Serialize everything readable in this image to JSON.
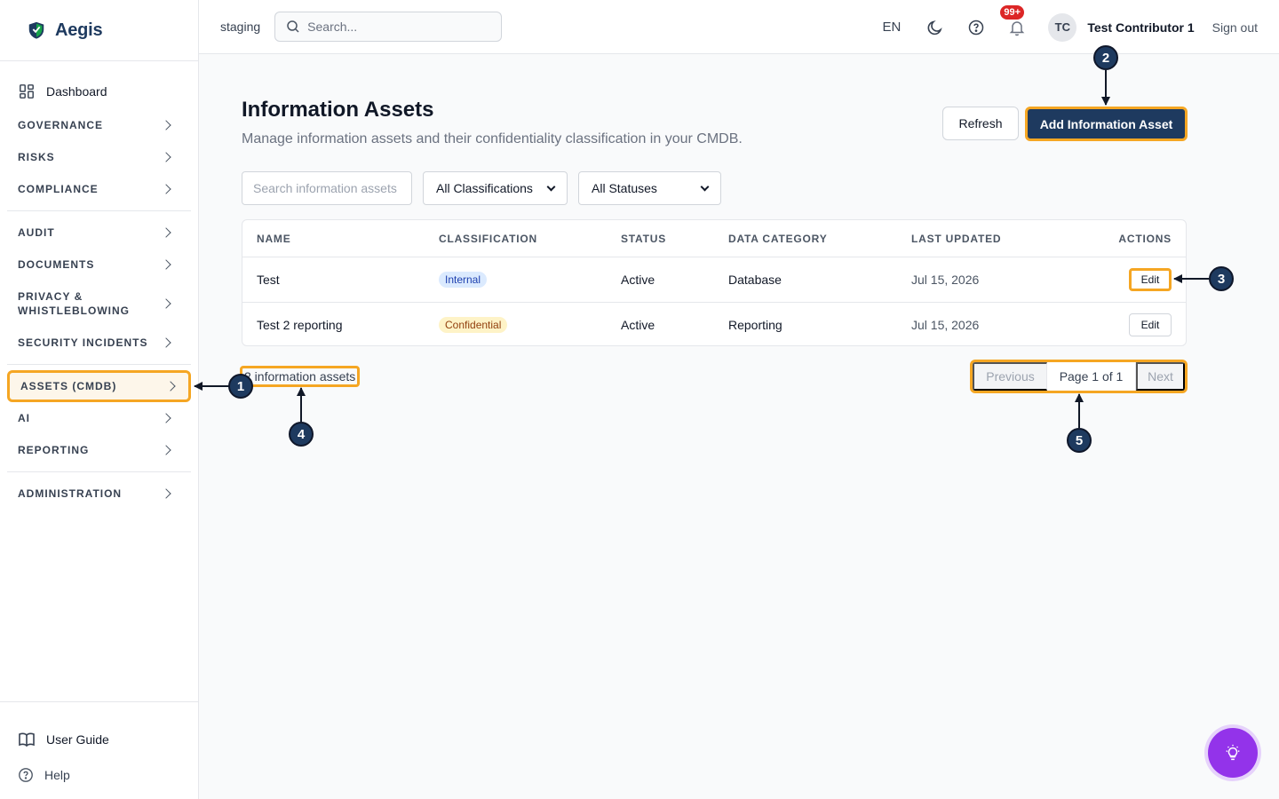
{
  "app": {
    "name": "Aegis",
    "environment": "staging"
  },
  "topbar": {
    "search_placeholder": "Search...",
    "language": "EN",
    "notification_badge": "99+",
    "avatar_initials": "TC",
    "user_name": "Test Contributor 1",
    "sign_out": "Sign out"
  },
  "sidebar": {
    "dashboard": "Dashboard",
    "items": [
      {
        "label": "GOVERNANCE"
      },
      {
        "label": "RISKS"
      },
      {
        "label": "COMPLIANCE"
      },
      {
        "label": "AUDIT"
      },
      {
        "label": "DOCUMENTS"
      },
      {
        "label": "PRIVACY & WHISTLEBLOWING"
      },
      {
        "label": "SECURITY INCIDENTS"
      },
      {
        "label": "ASSETS (CMDB)",
        "active": true
      },
      {
        "label": "AI"
      },
      {
        "label": "REPORTING"
      },
      {
        "label": "ADMINISTRATION"
      }
    ],
    "user_guide": "User Guide",
    "help": "Help"
  },
  "page": {
    "title": "Information Assets",
    "subtitle": "Manage information assets and their confidentiality classification in your CMDB.",
    "refresh_label": "Refresh",
    "add_label": "Add Information Asset"
  },
  "filters": {
    "search_placeholder": "Search information assets",
    "classification": "All Classifications",
    "status": "All Statuses"
  },
  "table": {
    "columns": [
      "NAME",
      "CLASSIFICATION",
      "STATUS",
      "DATA CATEGORY",
      "LAST UPDATED",
      "ACTIONS"
    ],
    "rows": [
      {
        "name": "Test",
        "classification": "Internal",
        "status": "Active",
        "category": "Database",
        "updated": "Jul 15, 2026",
        "action": "Edit"
      },
      {
        "name": "Test 2 reporting",
        "classification": "Confidential",
        "status": "Active",
        "category": "Reporting",
        "updated": "Jul 15, 2026",
        "action": "Edit"
      }
    ]
  },
  "footer": {
    "count_text": "2 information assets",
    "previous": "Previous",
    "page_info": "Page 1 of 1",
    "next": "Next"
  },
  "callouts": [
    "1",
    "2",
    "3",
    "4",
    "5"
  ],
  "colors": {
    "brand": "#1e3a5f",
    "highlight": "#f5a623",
    "fab": "#9333ea",
    "badge": "#dc2626"
  }
}
